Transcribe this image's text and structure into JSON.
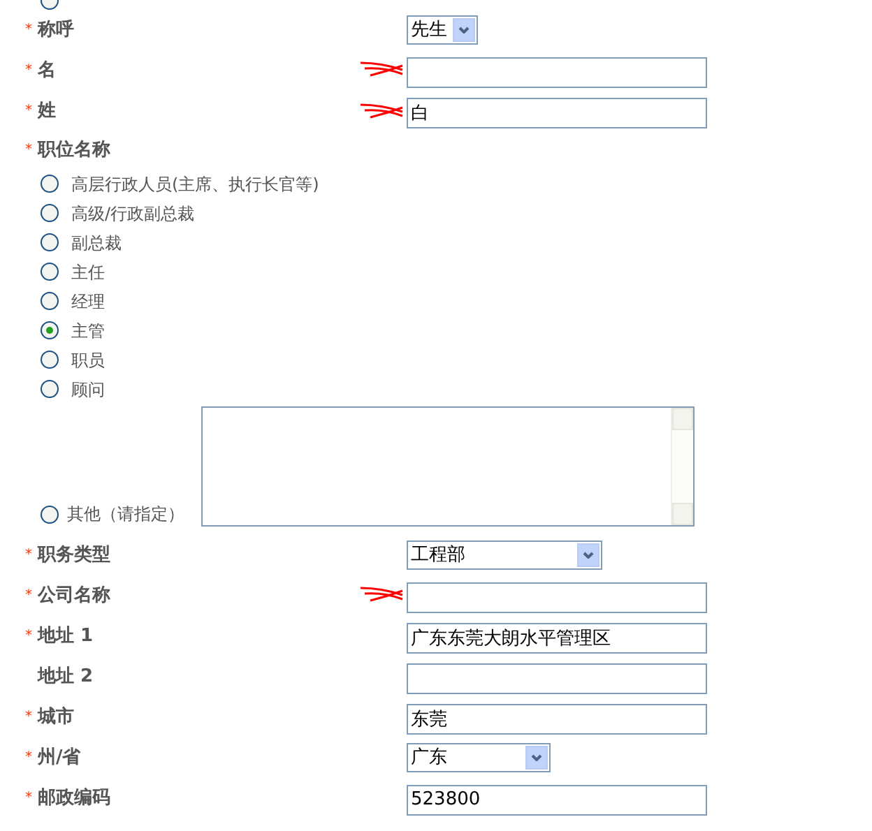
{
  "top_option": {
    "selected": false
  },
  "rows": [
    {
      "kind": "select",
      "label": "称呼",
      "required_mark": "*",
      "value": "先生"
    },
    {
      "kind": "text",
      "label": "名",
      "required_mark": "*",
      "redacted": true
    },
    {
      "kind": "text",
      "label": "姓",
      "required_mark": "*",
      "value": "白",
      "redacted": true
    },
    {
      "kind": "radio_group",
      "label": "职位名称",
      "required_mark": "*",
      "options": [
        {
          "label": "高层行政人员(主席、执行长官等)",
          "selected": false
        },
        {
          "label": "高级/行政副总裁",
          "selected": false
        },
        {
          "label": "副总裁",
          "selected": false
        },
        {
          "label": "主任",
          "selected": false
        },
        {
          "label": "经理",
          "selected": false
        },
        {
          "label": "主管",
          "selected": true
        },
        {
          "label": "职员",
          "selected": false
        },
        {
          "label": "顾问",
          "selected": false
        }
      ],
      "other": {
        "label": "其他（请指定）",
        "selected": false
      }
    },
    {
      "kind": "select",
      "label": "职务类型",
      "required_mark": "*",
      "value": "工程部"
    },
    {
      "kind": "text",
      "label": "公司名称",
      "required_mark": "*",
      "redacted": true
    },
    {
      "kind": "text",
      "label": "地址 1",
      "required_mark": "*",
      "value": "广东东莞大朗水平管理区"
    },
    {
      "kind": "text",
      "label": "地址 2"
    },
    {
      "kind": "text",
      "label": "城市",
      "required_mark": "*",
      "value": "东莞"
    },
    {
      "kind": "select",
      "label": "州/省",
      "required_mark": "*",
      "value": "广东"
    },
    {
      "kind": "text",
      "label": "邮政编码",
      "required_mark": "*",
      "value": "523800"
    }
  ]
}
